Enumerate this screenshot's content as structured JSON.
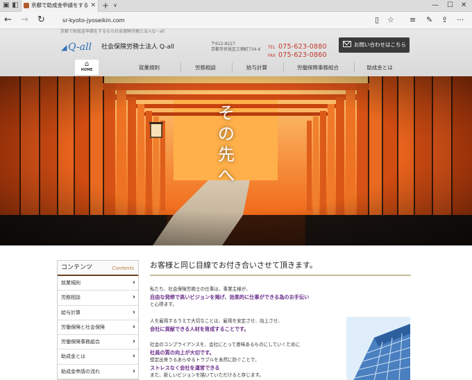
{
  "browser": {
    "tab_title": "京都で助成金申請をする",
    "url": "sr-kyoto-jyoseikin.com"
  },
  "header": {
    "tagline": "京都で助成金申請をするなら社会保険労務士法人Q－all",
    "logo_text": "Q-all",
    "company_name": "社会保険労務士法人 Q-all",
    "postal": "〒612-8227",
    "address": "京都市伏見区三栖町734-6",
    "tel_label": "TEL",
    "tel": "075-623-0880",
    "fax_label": "FAX",
    "fax": "075-623-0860",
    "contact_button": "お問い合わせはこちら"
  },
  "gnav": {
    "home": "HOME",
    "items": [
      "就業規則",
      "労務相談",
      "給与計算",
      "労働保険事務組合",
      "助成金とは"
    ]
  },
  "hero": {
    "copy": "その先へ"
  },
  "sidebar": {
    "title": "コンテンツ",
    "title_en": "Contents",
    "items": [
      "就業規則",
      "労務相談",
      "給与計算",
      "労働保険と社会保険",
      "労働保険事務組合",
      "助成金とは",
      "助成金申請の流れ"
    ]
  },
  "main": {
    "title": "お客様と同じ目線でお付き合いさせて頂きます。",
    "p1_a": "私たち、社会保険労務士の仕事は、事業主様が、",
    "p1_em": "自由な発想で高いビジョンを掲げ、効果的に仕事ができる為のお手伝い",
    "p1_b": "と心得ます。",
    "p2_a": "人を雇用するうえで大切なことは、雇用を安定させ、向上させ、",
    "p2_em": "会社に貢献できる人材を育成することです。",
    "p3_a": "社会のコンプライアンスを、会社にとって意味あるものにしていくために",
    "p3_em": "社員の質の向上が大切です。",
    "p3_b": "想定出来うるあらゆるトラブルを未然に防ぐことで、",
    "p3_em2": "ストレスなく会社を運営できる",
    "p3_c": "また、新しいビジョンを描いていただけると存じます。"
  },
  "colors": {
    "accent_red": "#c0392b",
    "purple_text": "#6a2c8a",
    "logo_blue": "#2f6fb7",
    "sidebar_rule": "#6b3e1e"
  }
}
